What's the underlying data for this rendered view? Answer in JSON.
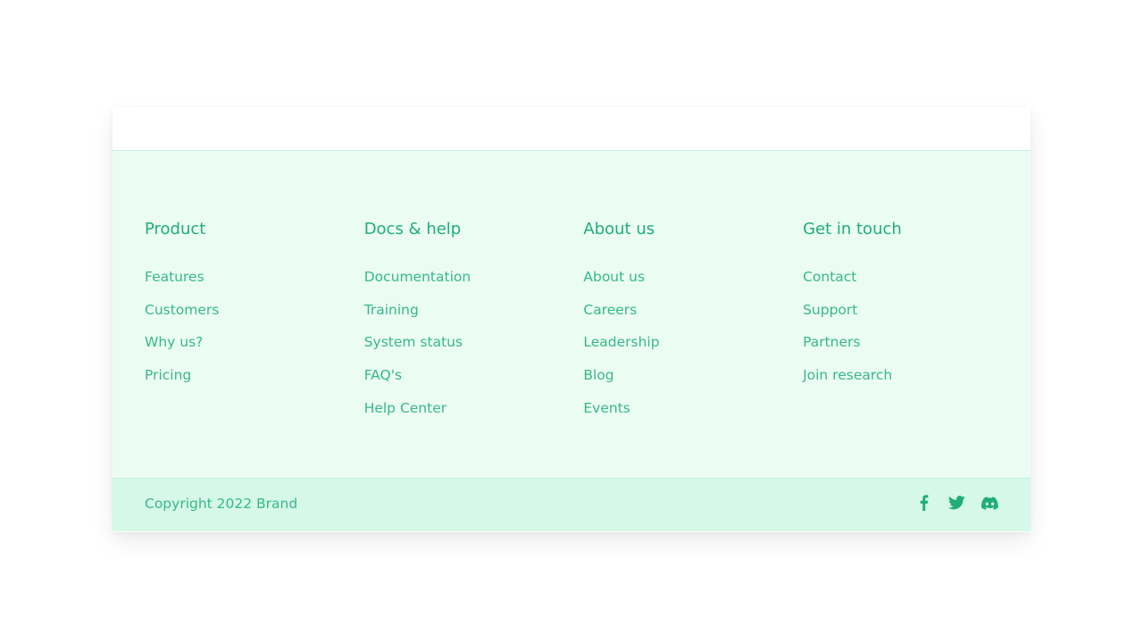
{
  "accent_color": "#1fae78",
  "footer": {
    "columns": [
      {
        "title": "Product",
        "links": [
          "Features",
          "Customers",
          "Why us?",
          "Pricing"
        ]
      },
      {
        "title": "Docs & help",
        "links": [
          "Documentation",
          "Training",
          "System status",
          "FAQ's",
          "Help Center"
        ]
      },
      {
        "title": "About us",
        "links": [
          "About us",
          "Careers",
          "Leadership",
          "Blog",
          "Events"
        ]
      },
      {
        "title": "Get in touch",
        "links": [
          "Contact",
          "Support",
          "Partners",
          "Join research"
        ]
      }
    ],
    "copyright": "Copyright 2022 Brand",
    "socials": [
      "facebook-icon",
      "twitter-icon",
      "discord-icon"
    ]
  }
}
